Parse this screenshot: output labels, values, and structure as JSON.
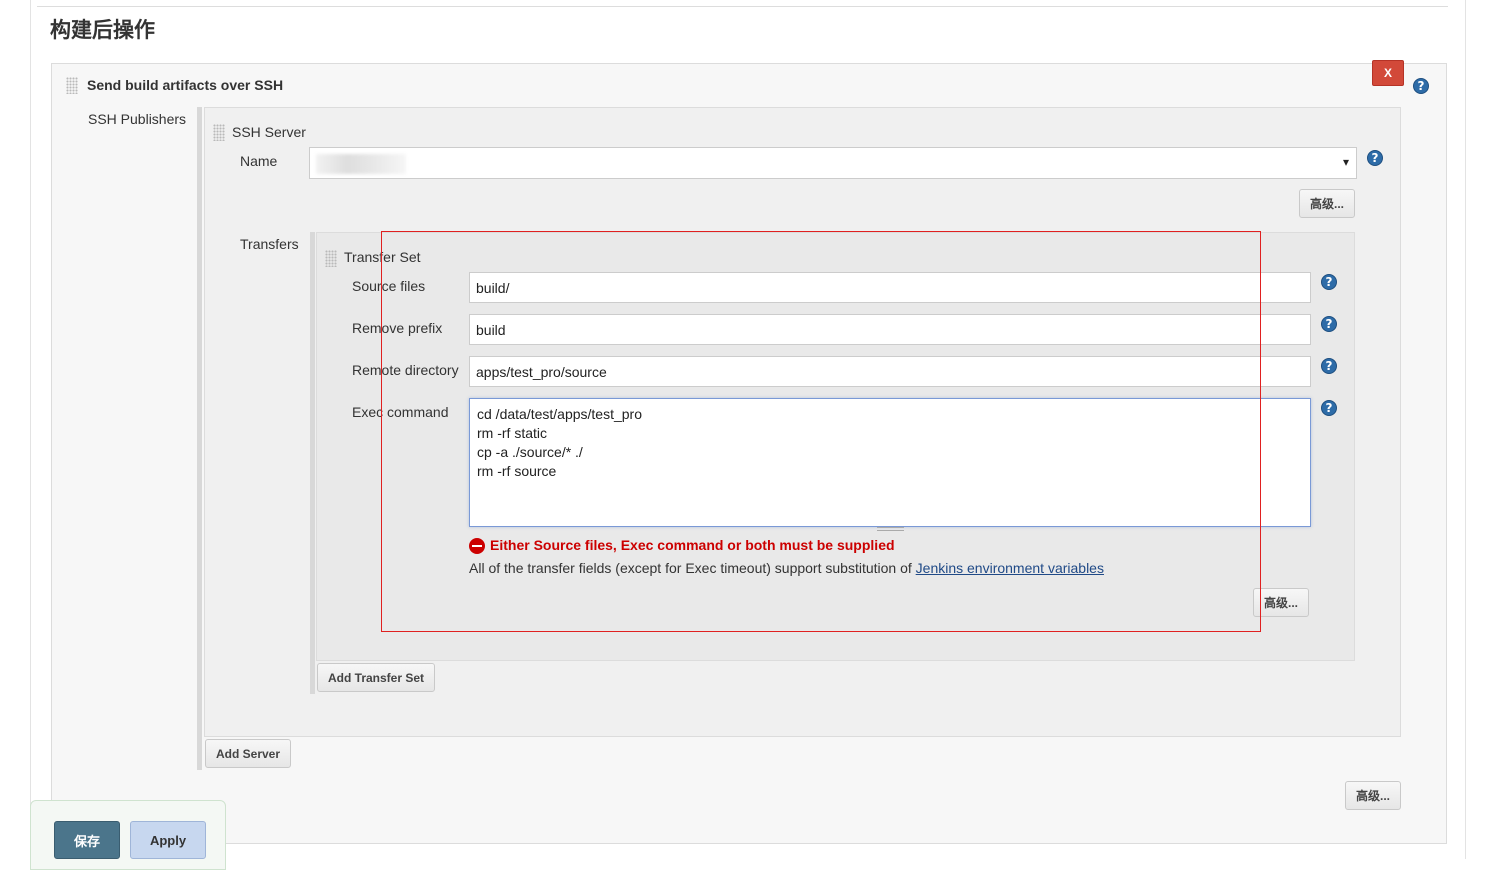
{
  "section_title": "构建后操作",
  "publisher": {
    "title": "Send build artifacts over SSH",
    "delete_label": "X",
    "ssh_publishers_label": "SSH Publishers",
    "advanced_label": "高级..."
  },
  "server": {
    "title": "SSH Server",
    "name_label": "Name",
    "name_caret": "▾",
    "advanced_label": "高级...",
    "transfers_label": "Transfers",
    "add_server_label": "Add Server"
  },
  "transfer_set": {
    "title": "Transfer Set",
    "source_files_label": "Source files",
    "source_files_value": "build/",
    "remove_prefix_label": "Remove prefix",
    "remove_prefix_value": "build",
    "remote_directory_label": "Remote directory",
    "remote_directory_value": "apps/test_pro/source",
    "exec_command_label": "Exec command",
    "exec_command_value": "cd /data/test/apps/test_pro\nrm -rf static\ncp -a ./source/* ./\nrm -rf source",
    "error_message": "Either Source files, Exec command or both must be supplied",
    "info_text": "All of the transfer fields (except for Exec timeout) support substitution of",
    "env_link": "Jenkins environment variables",
    "advanced_label": "高级...",
    "add_transfer_set_label": "Add Transfer Set"
  },
  "help_glyph": "?",
  "footer": {
    "save_label": "保存",
    "apply_label": "Apply"
  },
  "colors": {
    "save_button": "#4b758b",
    "apply_button": "#c7d7ef",
    "error_text": "#cc0000",
    "delete_button": "#d24939",
    "help_icon": "#2e6ca8",
    "highlight_box": "#e02020"
  }
}
